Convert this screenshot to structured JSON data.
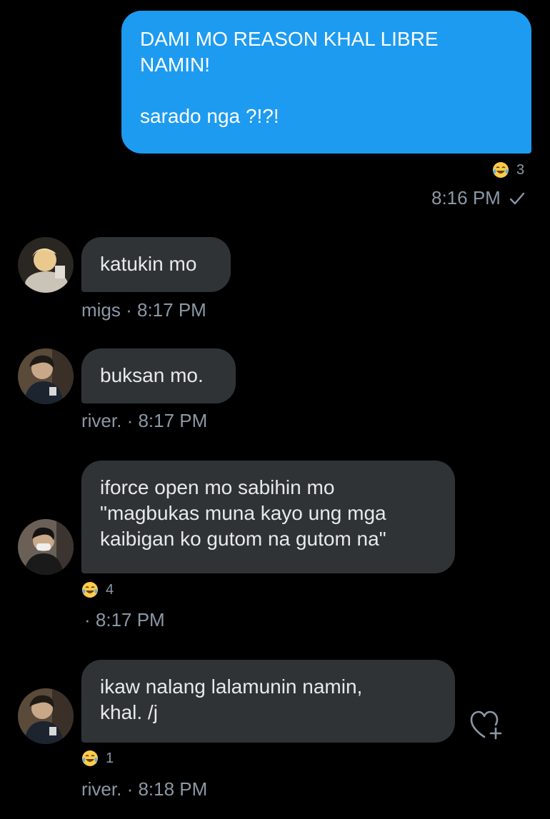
{
  "colors": {
    "background": "#000000",
    "outgoing_bubble": "#1d9bf0",
    "incoming_bubble": "#2f3336",
    "meta_text": "#8b98a5",
    "text": "#e7e9ea"
  },
  "messages": [
    {
      "direction": "outgoing",
      "text": "DAMI MO REASON KHAL LIBRE NAMIN!\n\nsarado nga ?!?!",
      "reaction_icon": "tears-of-joy-emoji",
      "reaction_count": "3",
      "time": "8:16 PM",
      "status_icon": "checkmark-icon"
    },
    {
      "direction": "incoming",
      "text": "katukin mo",
      "meta": "migs · 8:17 PM",
      "avatar_icon": "avatar-blonde"
    },
    {
      "direction": "incoming",
      "text": "buksan mo.",
      "meta": "river. · 8:17 PM",
      "avatar_icon": "avatar-dark"
    },
    {
      "direction": "incoming",
      "text": "iforce open mo sabihin mo\n\"magbukas muna kayo ung mga\nkaibigan ko gutom na gutom na\"",
      "reaction_icon": "tears-of-joy-emoji",
      "reaction_count": "4",
      "meta": "· 8:17 PM",
      "avatar_icon": "avatar-mask"
    },
    {
      "direction": "incoming",
      "text": "ikaw nalang lalamunin namin,\nkhal. /j",
      "reaction_icon": "tears-of-joy-emoji",
      "reaction_count": "1",
      "meta": "river. · 8:18 PM",
      "avatar_icon": "avatar-dark",
      "action_icon": "heart-plus-icon"
    }
  ]
}
